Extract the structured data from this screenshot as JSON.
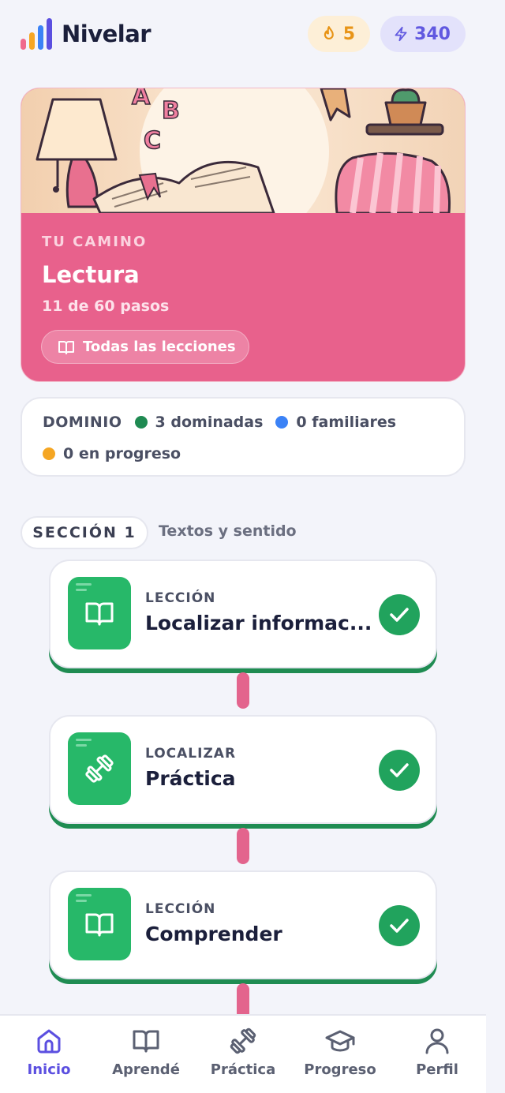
{
  "app": {
    "name": "Nivelar"
  },
  "header": {
    "streak": {
      "value": "5",
      "icon": "flame-icon",
      "color": "#e89416"
    },
    "xp": {
      "value": "340",
      "icon": "bolt-icon",
      "color": "#6159e0"
    }
  },
  "path": {
    "kicker": "TU CAMINO",
    "title": "Lectura",
    "progress_text": "11 de 60 pasos",
    "progress_fraction": 0.1833,
    "all_lessons_label": "Todas las lecciones",
    "color": "#e8618c"
  },
  "mastery": {
    "label": "DOMINIO",
    "items": [
      {
        "text": "3 dominadas",
        "color": "#1f8a52"
      },
      {
        "text": "0 familiares",
        "color": "#3b82f6"
      },
      {
        "text": "0 en progreso",
        "color": "#f5a623"
      }
    ]
  },
  "section": {
    "label": "SECCIÓN 1",
    "subtitle": "Textos y sentido"
  },
  "lessons": [
    {
      "kicker": "LECCIÓN",
      "title": "Localizar informac...",
      "icon": "book-icon",
      "completed": true
    },
    {
      "kicker": "LOCALIZAR",
      "title": "Práctica",
      "icon": "dumbbell-icon",
      "completed": true
    },
    {
      "kicker": "LECCIÓN",
      "title": "Comprender",
      "icon": "book-icon",
      "completed": true
    }
  ],
  "nav": {
    "items": [
      {
        "label": "Inicio",
        "icon": "home-icon",
        "active": true
      },
      {
        "label": "Aprendé",
        "icon": "book-icon",
        "active": false
      },
      {
        "label": "Práctica",
        "icon": "dumbbell-icon",
        "active": false
      },
      {
        "label": "Progreso",
        "icon": "graduation-cap-icon",
        "active": false
      },
      {
        "label": "Perfil",
        "icon": "user-icon",
        "active": false
      }
    ],
    "active_color": "#5b4fe0"
  }
}
